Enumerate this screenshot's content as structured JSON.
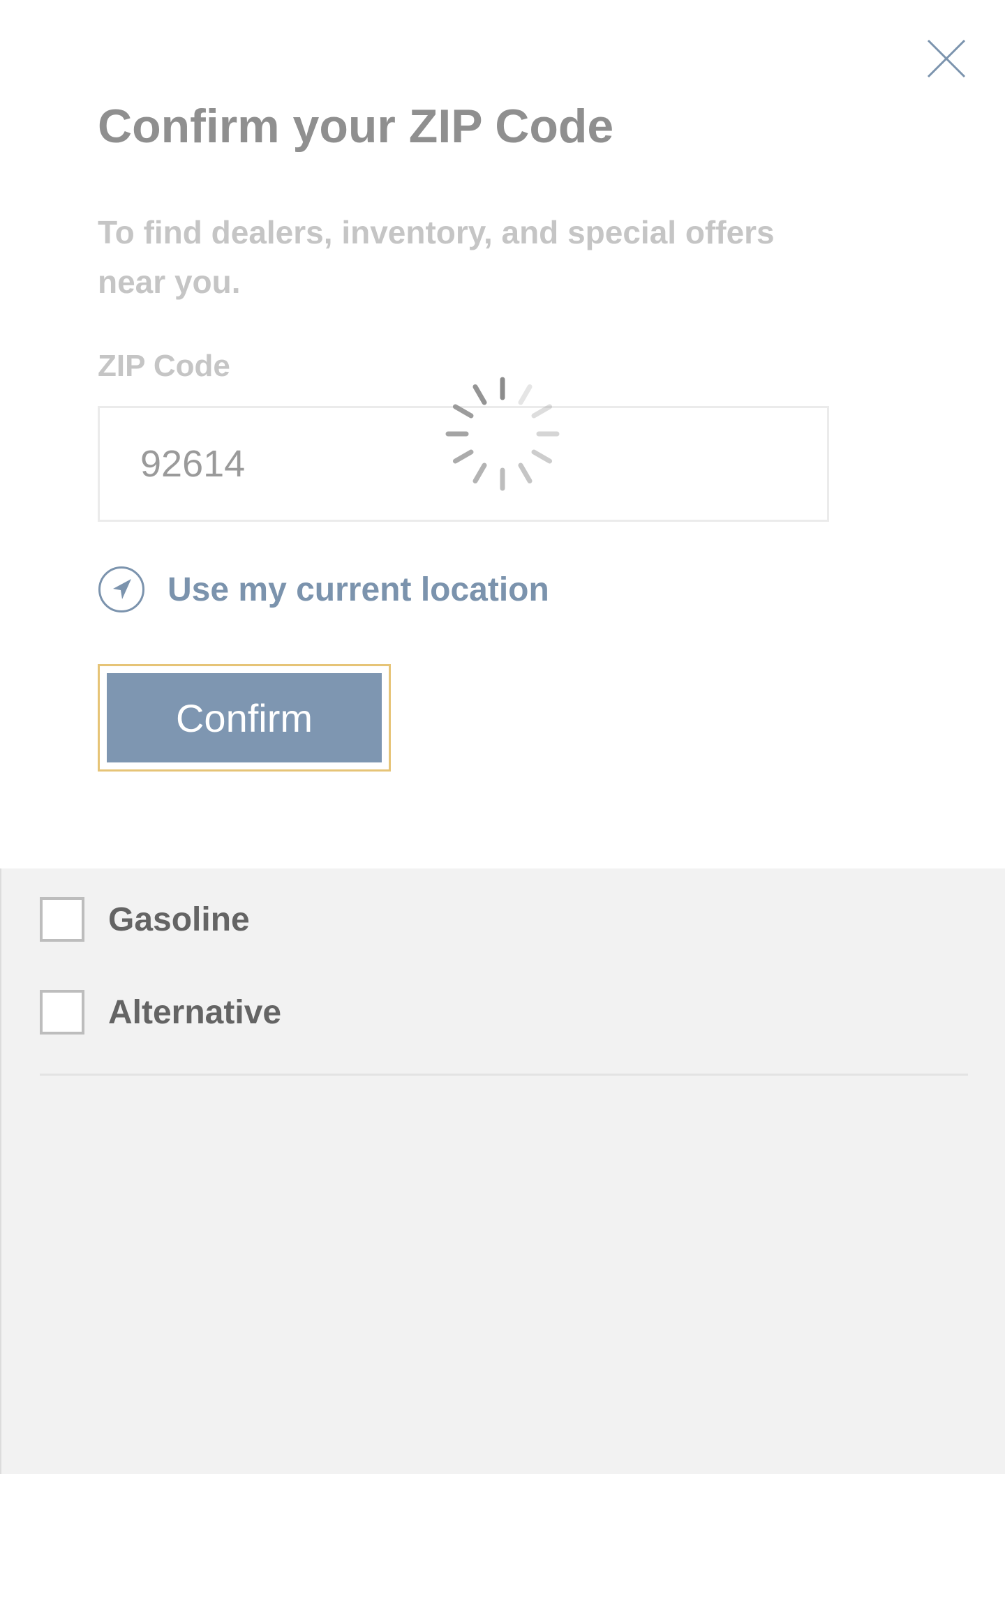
{
  "modal": {
    "title": "Confirm your ZIP Code",
    "subtitle": "To find dealers, inventory, and special offers near you.",
    "zip_label": "ZIP Code",
    "zip_value": "92614",
    "use_location_label": "Use my current location",
    "confirm_label": "Confirm",
    "close_icon": "close-icon",
    "location_icon": "navigation-arrow-icon",
    "loading": true
  },
  "filters": {
    "options": [
      {
        "label": "Gasoline",
        "checked": false
      },
      {
        "label": "Alternative",
        "checked": false
      }
    ]
  },
  "colors": {
    "accent": "#7e96b1",
    "link": "#7b93ad",
    "focus_outline": "#e6c477",
    "panel_background": "#f2f2f2"
  }
}
